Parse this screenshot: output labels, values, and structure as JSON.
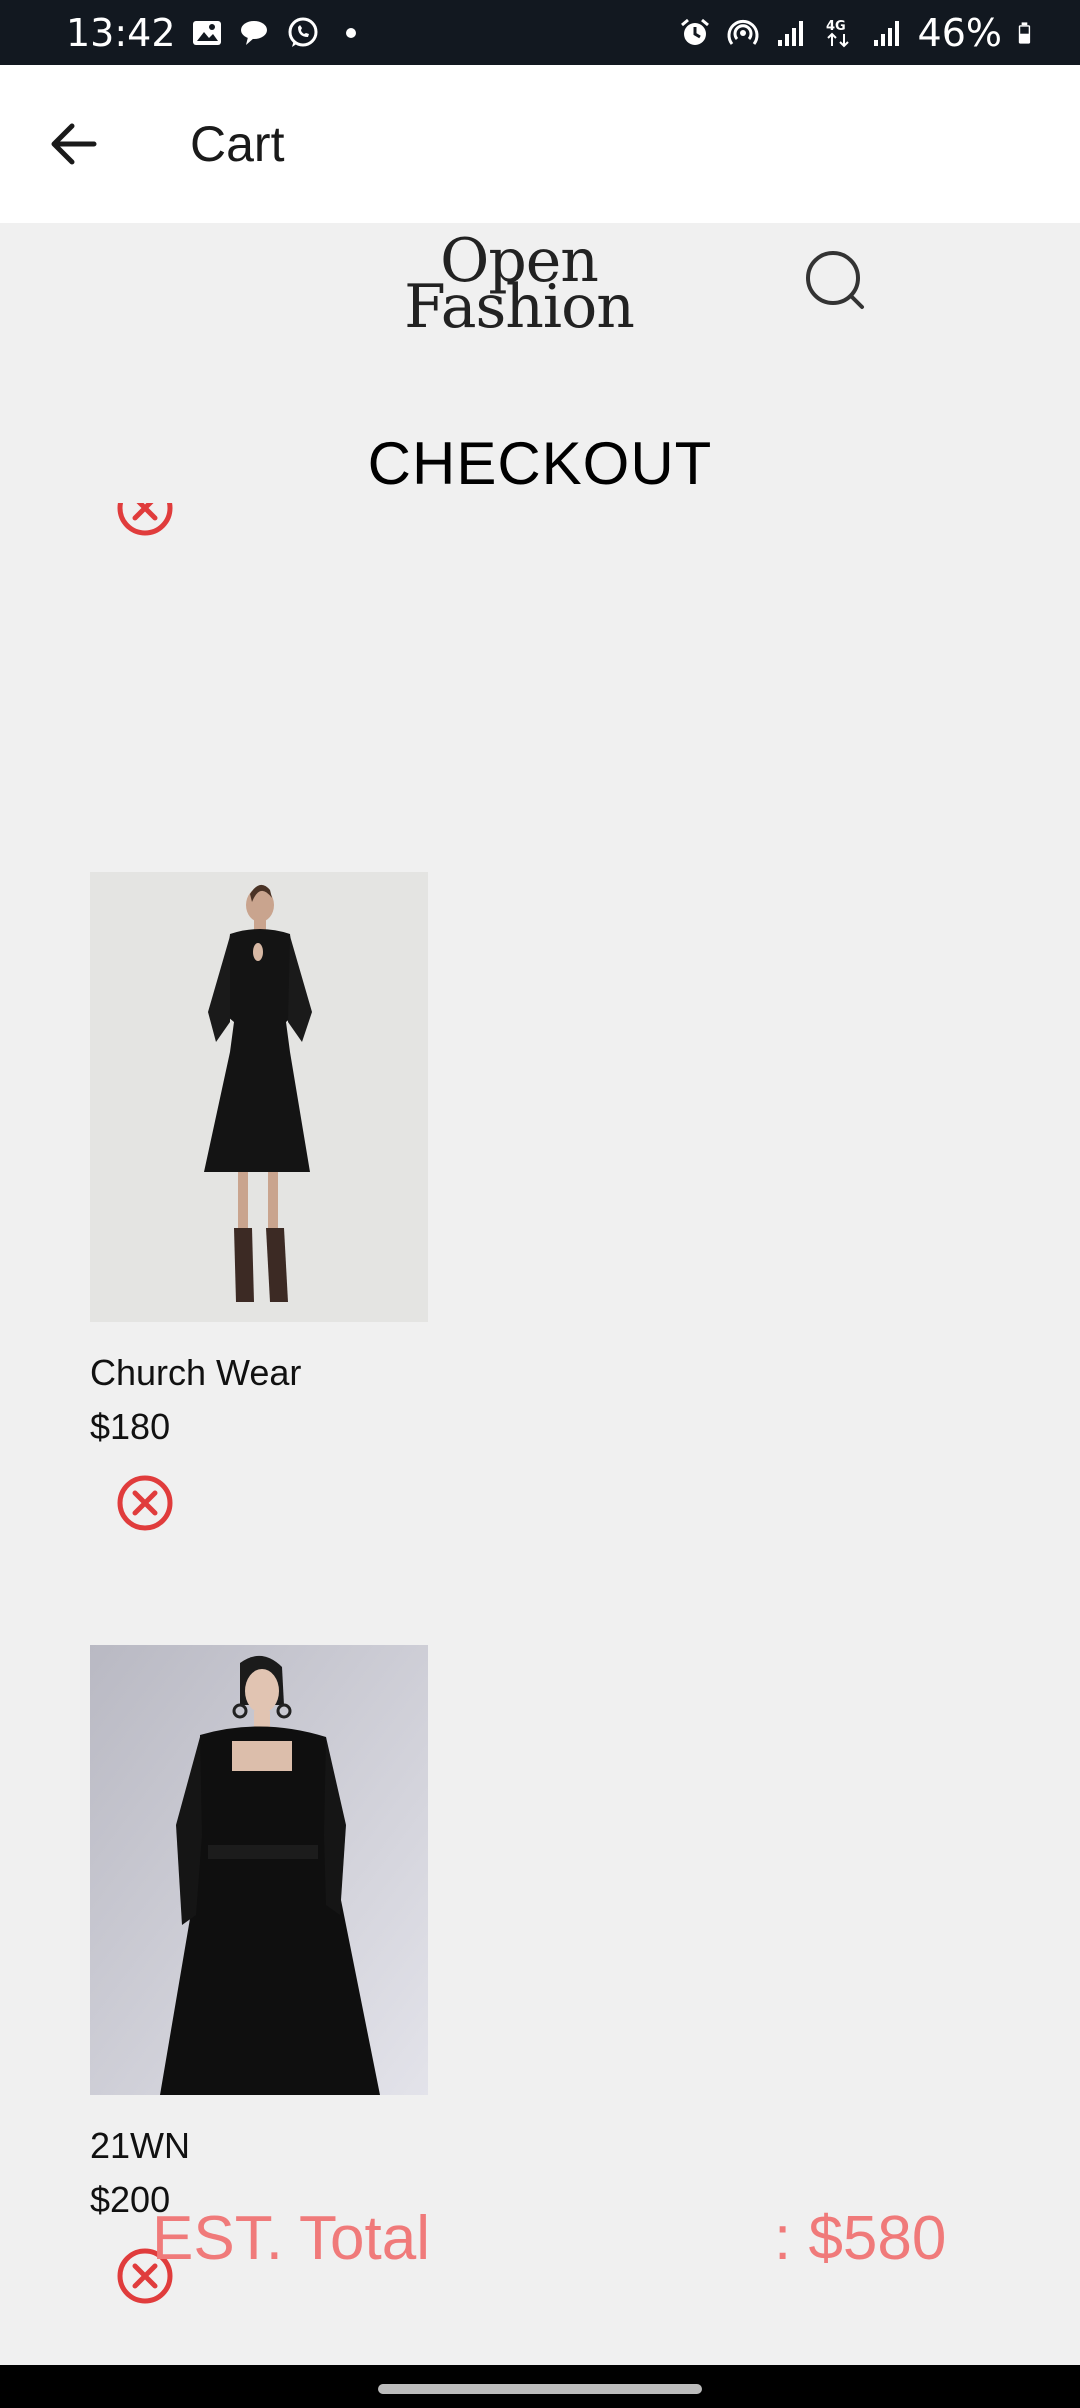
{
  "status_bar": {
    "time": "13:42",
    "battery_percent": "46%",
    "left_icons": [
      "gallery-icon",
      "chat-bubbles-icon",
      "whatsapp-icon",
      "dot-icon"
    ],
    "right_icons": [
      "alarm-icon",
      "hotspot-icon",
      "signal-icon",
      "4g-icon",
      "signal-icon",
      "battery-icon"
    ]
  },
  "app_bar": {
    "back_icon": "arrow-left-icon",
    "title": "Cart"
  },
  "header": {
    "logo_line1": "Open",
    "logo_line2": "Fashion",
    "search_icon": "search-icon"
  },
  "page_title": "CHECKOUT",
  "cart_items": [
    {
      "name": "Church Wear",
      "price": "$180",
      "photo": "black-long-sleeve-dress-with-keyhole-neckline",
      "remove_icon": "close-circle-icon"
    },
    {
      "name": "21WN",
      "price": "$200",
      "photo": "black-square-neck-flared-dress",
      "remove_icon": "close-circle-icon"
    }
  ],
  "total": {
    "label": "EST. Total",
    "value": ": $580"
  },
  "colors": {
    "status_bar_bg": "#121820",
    "page_bg": "#f0f0f0",
    "accent_total": "#f07a7a",
    "remove_red": "#e03c3c"
  }
}
